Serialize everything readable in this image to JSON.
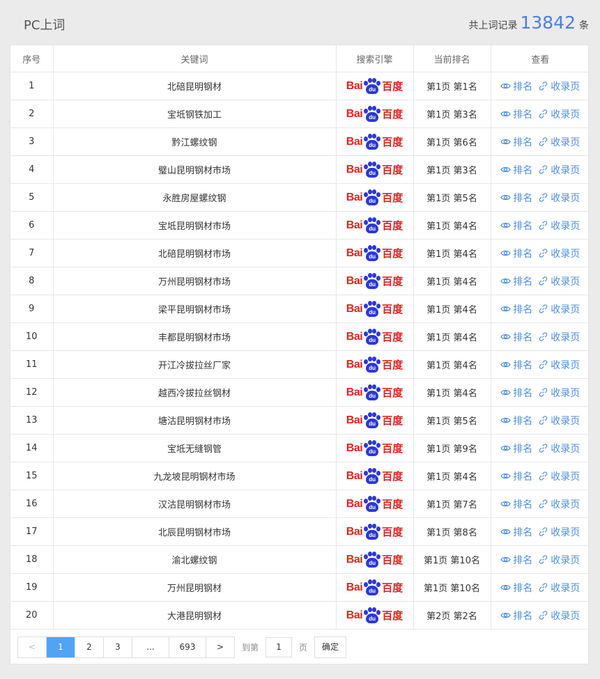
{
  "header": {
    "title": "PC上词",
    "total_prefix": "共上词记录",
    "total_count": "13842",
    "total_suffix": "条"
  },
  "table": {
    "columns": [
      "序号",
      "关键词",
      "搜索引擎",
      "当前排名",
      "查看"
    ],
    "engine": {
      "part1": "Bai",
      "paw_text": "du",
      "part2": "百度",
      "colors": {
        "red": "#de2320",
        "blue": "#2b38d8"
      }
    },
    "link_rank_label": "排名",
    "link_page_label": "收录页",
    "rows": [
      {
        "no": "1",
        "keyword": "北碚昆明钢材",
        "rank": "第1页 第1名"
      },
      {
        "no": "2",
        "keyword": "宝坻钢铁加工",
        "rank": "第1页 第3名"
      },
      {
        "no": "3",
        "keyword": "黔江螺纹钢",
        "rank": "第1页 第6名"
      },
      {
        "no": "4",
        "keyword": "璧山昆明钢材市场",
        "rank": "第1页 第3名"
      },
      {
        "no": "5",
        "keyword": "永胜房屋螺纹钢",
        "rank": "第1页 第5名"
      },
      {
        "no": "6",
        "keyword": "宝坻昆明钢材市场",
        "rank": "第1页 第4名"
      },
      {
        "no": "7",
        "keyword": "北碚昆明钢材市场",
        "rank": "第1页 第4名"
      },
      {
        "no": "8",
        "keyword": "万州昆明钢材市场",
        "rank": "第1页 第4名"
      },
      {
        "no": "9",
        "keyword": "梁平昆明钢材市场",
        "rank": "第1页 第4名"
      },
      {
        "no": "10",
        "keyword": "丰都昆明钢材市场",
        "rank": "第1页 第4名"
      },
      {
        "no": "11",
        "keyword": "开江冷拔拉丝厂家",
        "rank": "第1页 第4名"
      },
      {
        "no": "12",
        "keyword": "越西冷拔拉丝钢材",
        "rank": "第1页 第4名"
      },
      {
        "no": "13",
        "keyword": "塘沽昆明钢材市场",
        "rank": "第1页 第5名"
      },
      {
        "no": "14",
        "keyword": "宝坻无缝钢管",
        "rank": "第1页 第9名"
      },
      {
        "no": "15",
        "keyword": "九龙坡昆明钢材市场",
        "rank": "第1页 第4名"
      },
      {
        "no": "16",
        "keyword": "汉沽昆明钢材市场",
        "rank": "第1页 第7名"
      },
      {
        "no": "17",
        "keyword": "北辰昆明钢材市场",
        "rank": "第1页 第8名"
      },
      {
        "no": "18",
        "keyword": "渝北螺纹钢",
        "rank": "第1页 第10名"
      },
      {
        "no": "19",
        "keyword": "万州昆明钢材",
        "rank": "第1页 第10名"
      },
      {
        "no": "20",
        "keyword": "大港昆明钢材",
        "rank": "第2页 第2名"
      }
    ]
  },
  "pagination": {
    "prev": "<",
    "pages": [
      "1",
      "2",
      "3",
      "...",
      "693"
    ],
    "active_page": "1",
    "next": ">",
    "goto_label": "到第",
    "input_value": "1",
    "page_unit": "页",
    "confirm": "确定"
  },
  "colors": {
    "link": "#4f8fd8",
    "accent": "#4a7fe0",
    "active_page": "#51a3f5"
  }
}
